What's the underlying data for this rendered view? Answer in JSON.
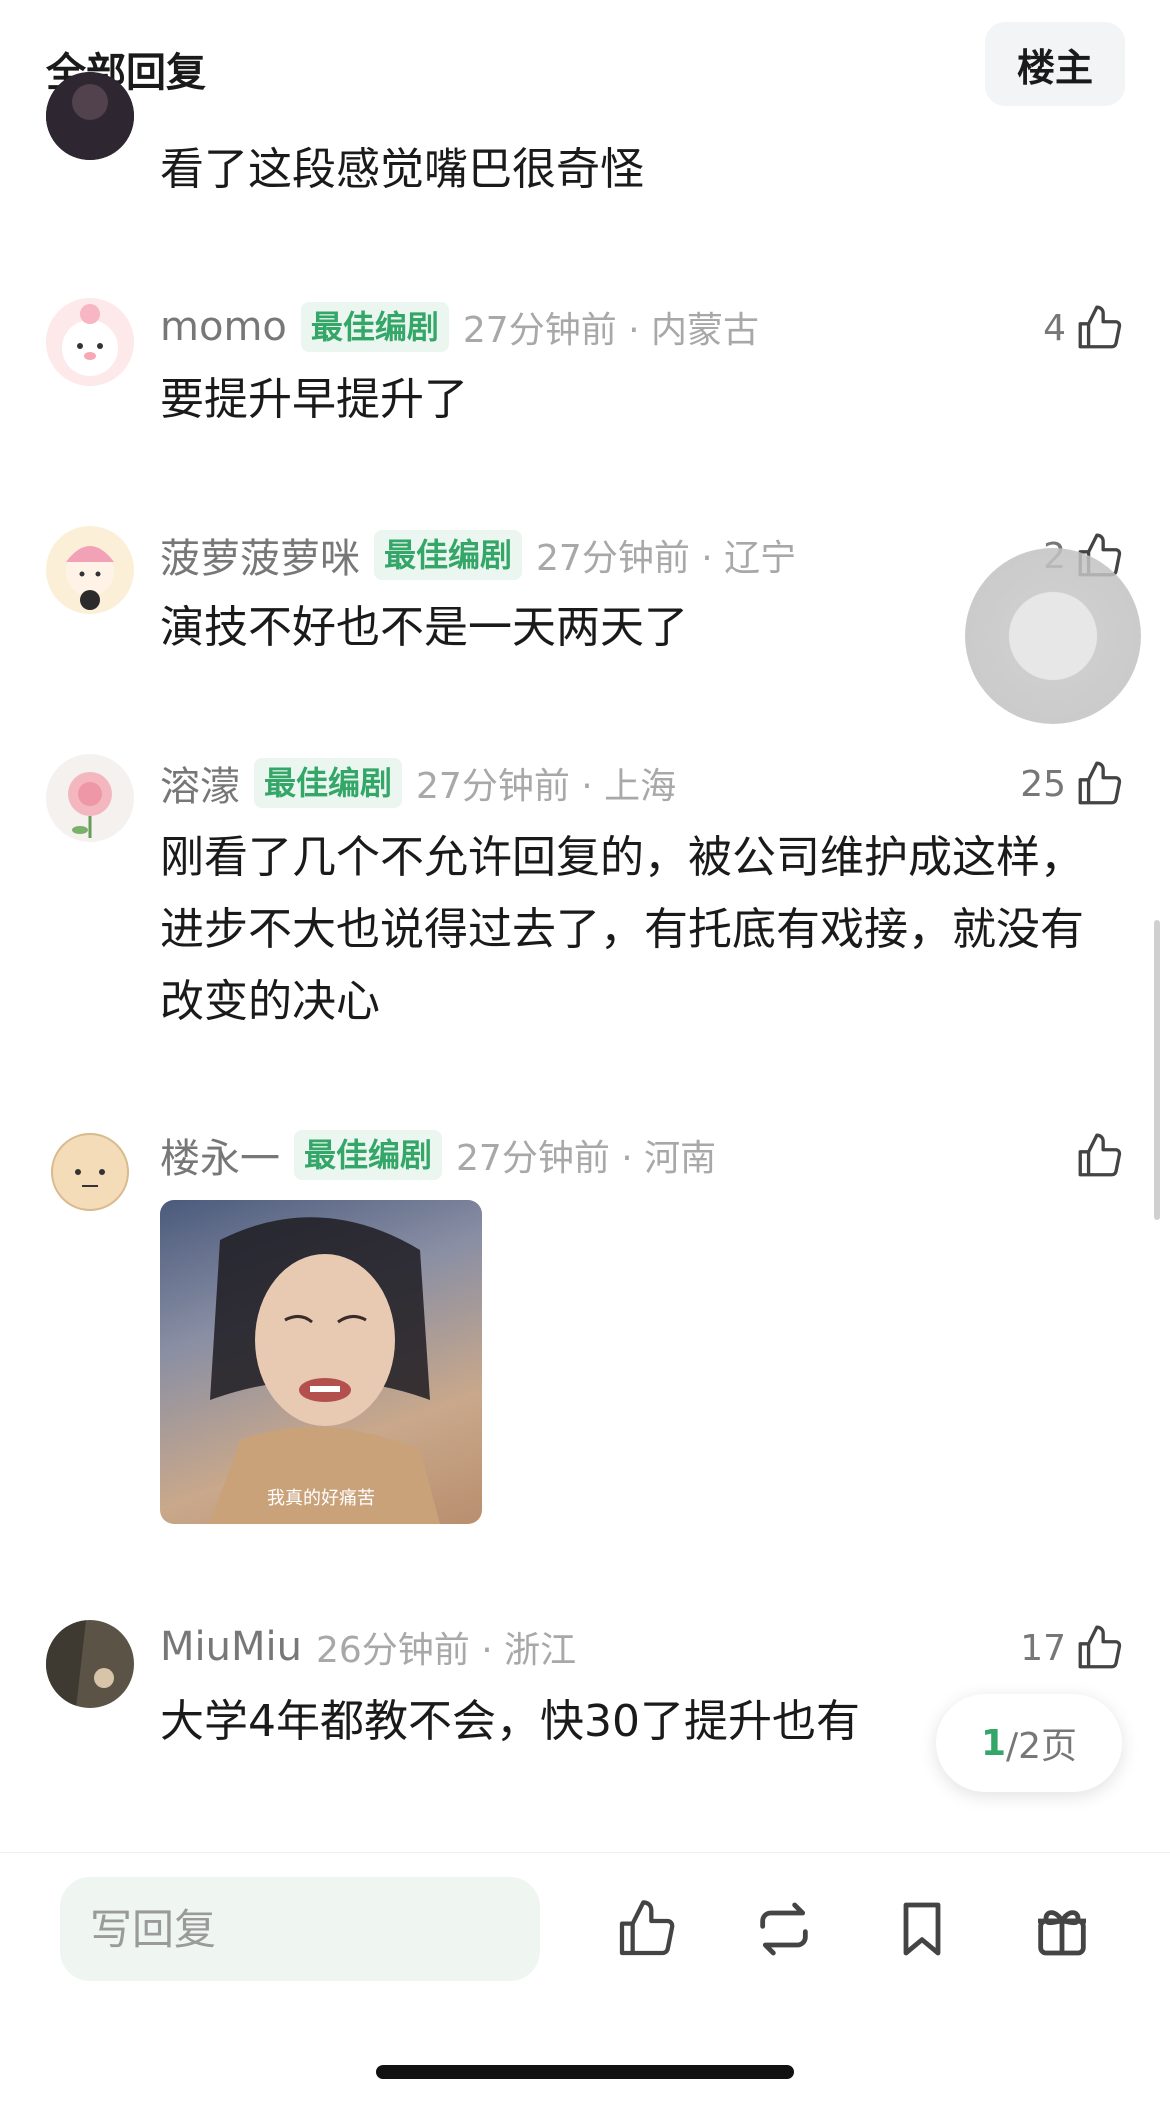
{
  "header": {
    "title": "全部回复",
    "owner_button": "楼主"
  },
  "comments": [
    {
      "username": "",
      "badge": "",
      "time": "",
      "likes": "",
      "text": "看了这段感觉嘴巴很奇怪"
    },
    {
      "username": "momo",
      "badge": "最佳编剧",
      "time": "27分钟前 · 内蒙古",
      "likes": "4",
      "text": "要提升早提升了"
    },
    {
      "username": "菠萝菠萝咪",
      "badge": "最佳编剧",
      "time": "27分钟前 · 辽宁",
      "likes": "2",
      "text": "演技不好也不是一天两天了"
    },
    {
      "username": "溶濛",
      "badge": "最佳编剧",
      "time": "27分钟前 · 上海",
      "likes": "25",
      "text": "刚看了几个不允许回复的，被公司维护成这样，进步不大也说得过去了，有托底有戏接，就没有改变的决心"
    },
    {
      "username": "楼永一",
      "badge": "最佳编剧",
      "time": "27分钟前 · 河南",
      "likes": "",
      "text": "",
      "image_caption": "我真的好痛苦"
    },
    {
      "username": "MiuMiu",
      "badge": "",
      "time": "26分钟前 · 浙江",
      "likes": "17",
      "text": "大学4年都教不会，快30了提升也有"
    }
  ],
  "pager": {
    "current": "1",
    "rest": "/2页"
  },
  "bottom_bar": {
    "reply_placeholder": "写回复",
    "icons": [
      "thumbs-up-icon",
      "repost-icon",
      "bookmark-icon",
      "gift-icon"
    ]
  },
  "colors": {
    "accent": "#33a668",
    "badge_bg": "#eaf6ef"
  }
}
